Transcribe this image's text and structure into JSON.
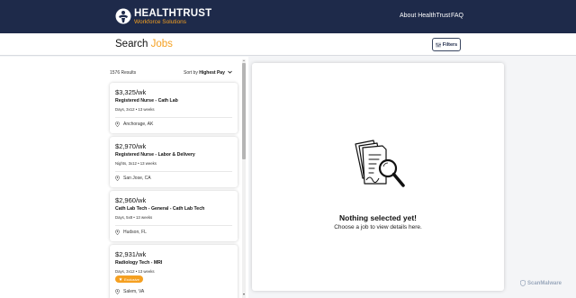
{
  "header": {
    "brand_title": "HEALTHTRUST",
    "brand_subtitle": "Workforce Solutions",
    "nav": [
      {
        "label": "About HealthTrust"
      },
      {
        "label": "FAQ"
      }
    ]
  },
  "search": {
    "title_prefix": "Search",
    "title_accent": "Jobs",
    "filters_label": "Filters"
  },
  "results": {
    "count_label": "1576 Results",
    "sort_prefix": "Sort by",
    "sort_value": "Highest Pay"
  },
  "jobs": [
    {
      "pay": "$3,325/wk",
      "title": "Registered Nurse - Cath Lab",
      "schedule": "Days, 3x12 • 13 weeks",
      "location": "Anchorage, AK"
    },
    {
      "pay": "$2,970/wk",
      "title": "Registered Nurse - Labor & Delivery",
      "schedule": "Nights, 3x12 • 13 weeks",
      "location": "San Jose, CA"
    },
    {
      "pay": "$2,960/wk",
      "title": "Cath Lab Tech - General - Cath Lab Tech",
      "schedule": "Days, 5x8 • 13 weeks",
      "location": "Hudson, FL"
    },
    {
      "pay": "$2,931/wk",
      "title": "Radiology Tech - MRI",
      "schedule": "Days, 3x12 • 13 weeks",
      "badge": "Exclusive",
      "location": "Salem, VA"
    }
  ],
  "detail": {
    "empty_title": "Nothing selected yet!",
    "empty_subtitle": "Choose a job to view details here."
  },
  "watermark": {
    "label": "ScanMalware"
  },
  "colors": {
    "header_bg": "#1e2a4a",
    "accent": "#f5a021"
  }
}
